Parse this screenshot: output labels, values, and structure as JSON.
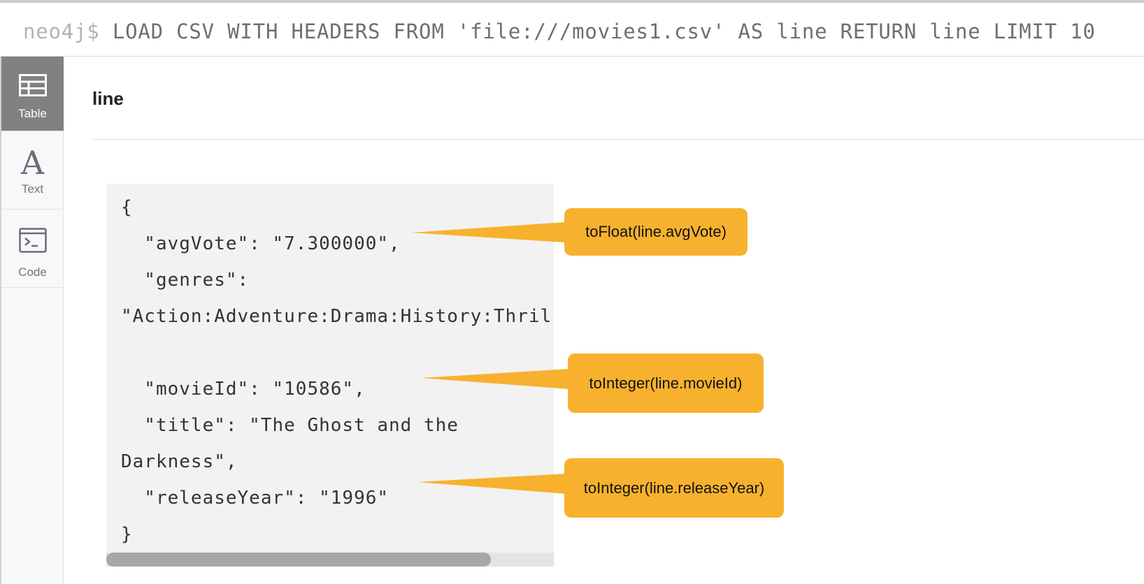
{
  "editor": {
    "prompt": "neo4j$",
    "query": "LOAD CSV WITH HEADERS FROM 'file:///movies1.csv' AS line RETURN line LIMIT 10"
  },
  "sidebar": {
    "tabs": [
      {
        "label": "Table",
        "icon": "table-icon",
        "active": true
      },
      {
        "label": "Text",
        "icon": "text-icon",
        "active": false
      },
      {
        "label": "Code",
        "icon": "terminal-icon",
        "active": false
      }
    ]
  },
  "results": {
    "column_header": "line",
    "cell_text": "{\n  \"avgVote\": \"7.300000\",\n  \"genres\":\n\"Action:Adventure:Drama:History:Thril\n\n  \"movieId\": \"10586\",\n  \"title\": \"The Ghost and the\nDarkness\",\n  \"releaseYear\": \"1996\"\n}",
    "scroll_fraction": 0.86
  },
  "annotations": {
    "avgvote": "toFloat(line.avgVote)",
    "movieid": "toInteger(line.movieId)",
    "releaseyear": "toInteger(line.releaseYear)",
    "color": "#f8b12e"
  }
}
